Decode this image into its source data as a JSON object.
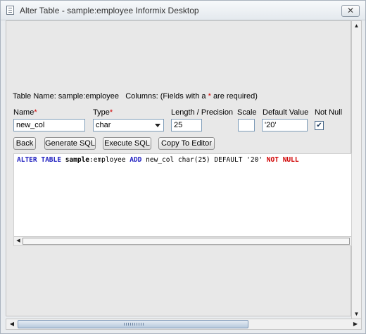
{
  "window": {
    "title": "Alter Table - sample:employee Informix Desktop",
    "close_glyph": "✕"
  },
  "form": {
    "table_name_label": "Table Name: sample:employee",
    "columns_prefix": "Columns: (Fields with a",
    "required_marker": "*",
    "columns_suffix": "are required)",
    "labels": {
      "name": "Name",
      "type": "Type",
      "length": "Length / Precision",
      "scale": "Scale",
      "default": "Default Value",
      "not_null": "Not Null"
    },
    "values": {
      "name": "new_col",
      "type": "char",
      "length": "25",
      "scale": "",
      "default": "'20'",
      "not_null_checked": true
    }
  },
  "buttons": {
    "back": "Back",
    "generate_sql": "Generate SQL",
    "execute_sql": "Execute SQL",
    "copy_to_editor": "Copy To Editor"
  },
  "sql": {
    "alter": "ALTER",
    "table": "TABLE",
    "db": "sample",
    "colon_table": ":employee",
    "add": "ADD",
    "column_def": "new_col char(25)",
    "default_kw": "DEFAULT",
    "default_val": "'20'",
    "not": "NOT",
    "null": "NULL"
  },
  "colors": {
    "required": "#d10000",
    "sql_keyword": "#2020c0",
    "sql_constraint": "#d00000"
  },
  "icons": [
    "window-icon",
    "close-icon",
    "chevron-down-icon",
    "checkmark-icon",
    "scroll-arrow-icons"
  ]
}
